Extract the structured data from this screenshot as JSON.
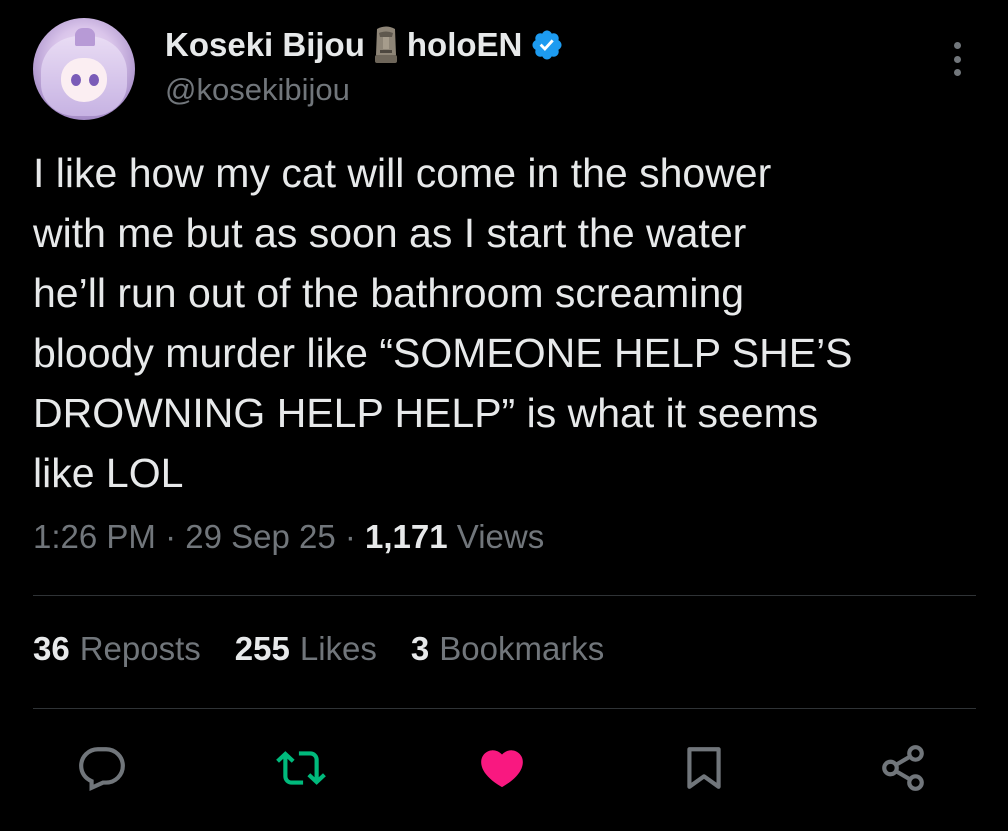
{
  "author": {
    "display_name": "Koseki Bijou",
    "name_suffix": "holoEN",
    "emoji": "moai-icon",
    "handle": "@kosekibijou",
    "verified": true
  },
  "tweet": {
    "text": "I like how my cat will come in the shower\nwith me but as soon as I start the water\nhe’ll run out of the bathroom screaming\nbloody murder like “SOMEONE HELP SHE’S\nDROWNING HELP HELP” is what it seems\nlike LOL",
    "time": "1:26 PM",
    "date": "29 Sep 25",
    "separator": " · ",
    "views_count": "1,171",
    "views_label": "Views"
  },
  "stats": {
    "reposts_count": "36",
    "reposts_label": "Reposts",
    "likes_count": "255",
    "likes_label": "Likes",
    "bookmarks_count": "3",
    "bookmarks_label": "Bookmarks"
  },
  "colors": {
    "background": "#000000",
    "text": "#e7e9ea",
    "muted": "#71767b",
    "verified": "#1d9bf0",
    "repost_active": "#00ba7c",
    "like_active": "#f91880",
    "divider": "#2f3336"
  },
  "actions": [
    "reply-icon",
    "repost-icon",
    "like-icon",
    "bookmark-icon",
    "share-icon"
  ]
}
